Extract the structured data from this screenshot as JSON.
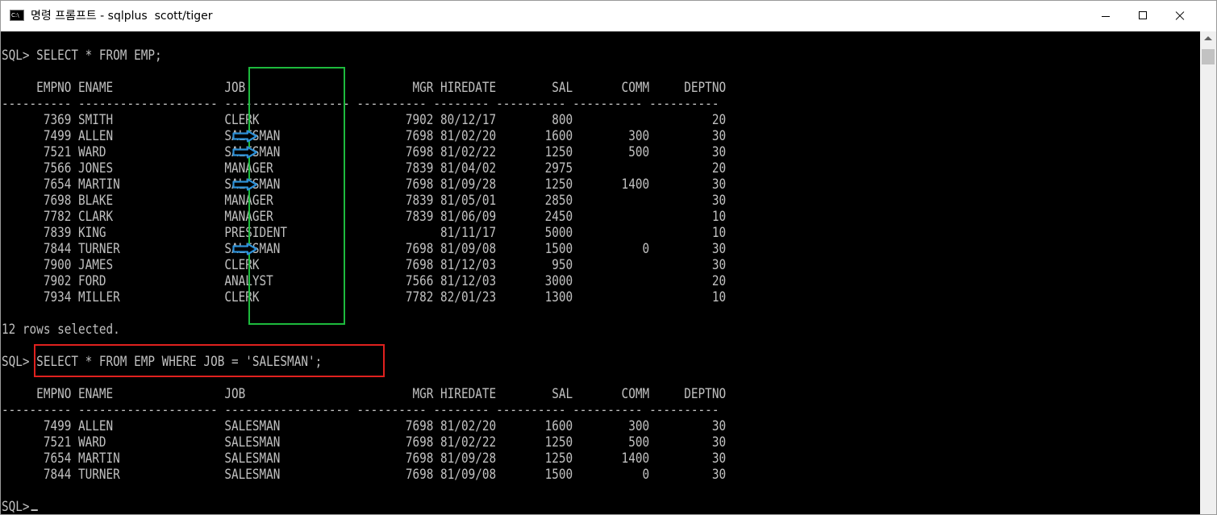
{
  "window": {
    "title": "명령 프롬프트 - sqlplus  scott/tiger",
    "icon": "cmd-icon",
    "icon_text": "C:\\"
  },
  "console": {
    "prompt": "SQL>",
    "query1": "SQL> SELECT * FROM EMP;",
    "header": "     EMPNO ENAME                JOB                        MGR HIREDATE        SAL       COMM     DEPTNO",
    "rule": "---------- -------------------- ------------------ ---------- -------- ---------- ---------- ----------",
    "rows1": [
      "      7369 SMITH                CLERK                     7902 80/12/17        800                    20",
      "      7499 ALLEN                SALESMAN                  7698 81/02/20       1600        300         30",
      "      7521 WARD                 SALESMAN                  7698 81/02/22       1250        500         30",
      "      7566 JONES                MANAGER                   7839 81/04/02       2975                    20",
      "      7654 MARTIN               SALESMAN                  7698 81/09/28       1250       1400         30",
      "      7698 BLAKE                MANAGER                   7839 81/05/01       2850                    30",
      "      7782 CLARK                MANAGER                   7839 81/06/09       2450                    10",
      "      7839 KING                 PRESIDENT                      81/11/17       5000                    10",
      "      7844 TURNER               SALESMAN                  7698 81/09/08       1500          0         30",
      "      7900 JAMES                CLERK                     7698 81/12/03        950                    30",
      "      7902 FORD                 ANALYST                   7566 81/12/03       3000                    20",
      "      7934 MILLER               CLERK                     7782 82/01/23       1300                    10"
    ],
    "rows_selected": "12 rows selected.",
    "query2": "SQL> SELECT * FROM EMP WHERE JOB = 'SALESMAN';",
    "rows2": [
      "      7499 ALLEN                SALESMAN                  7698 81/02/20       1600        300         30",
      "      7521 WARD                 SALESMAN                  7698 81/02/22       1250        500         30",
      "      7654 MARTIN               SALESMAN                  7698 81/09/28       1250       1400         30",
      "      7844 TURNER               SALESMAN                  7698 81/09/08       1500          0         30"
    ]
  },
  "annotations": {
    "job_box_color": "#1dba3d",
    "query_box_color": "#e0211e",
    "arrow_color": "#2c8fd6",
    "arrow_icon": "right-arrow-icon"
  },
  "colors": {
    "console_background": "#000000",
    "console_text": "#c0c0c0",
    "titlebar_background": "#ffffff"
  }
}
